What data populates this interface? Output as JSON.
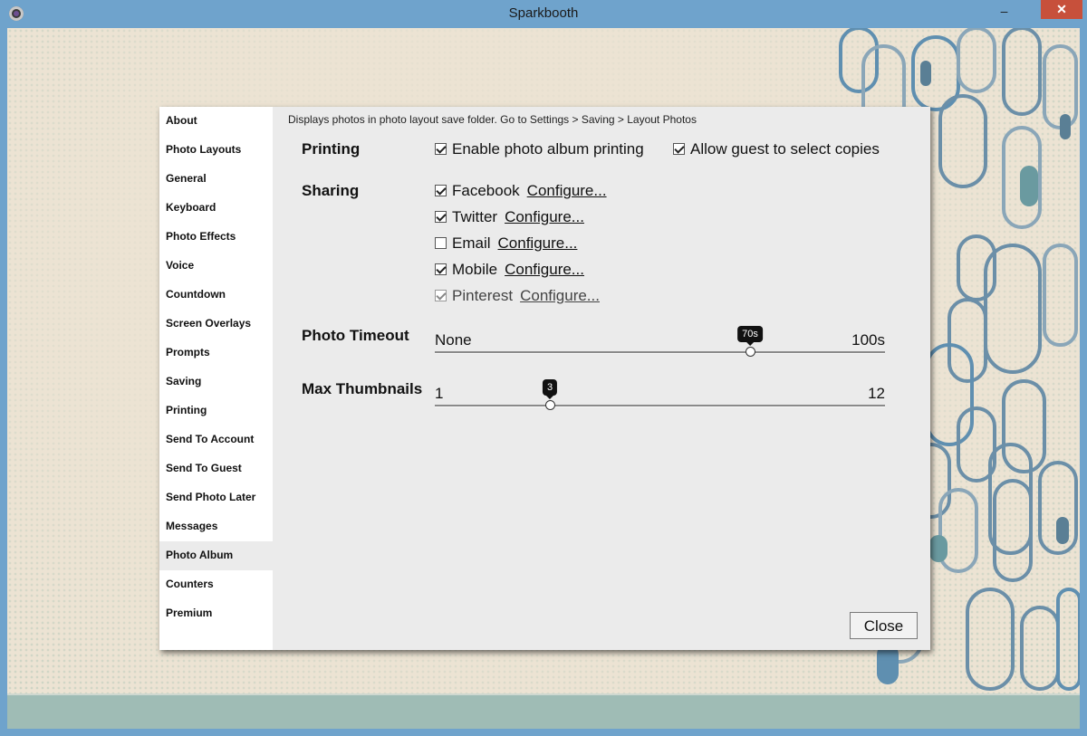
{
  "window": {
    "title": "Sparkbooth",
    "min_glyph": "–",
    "close_glyph": "✕"
  },
  "colors": {
    "titlebar": "#6fa3cc",
    "close": "#c7503b",
    "dialog": "#ebebeb",
    "sidebar": "#ffffff"
  },
  "sidebar": {
    "items": [
      {
        "label": "About"
      },
      {
        "label": "Photo Layouts"
      },
      {
        "label": "General"
      },
      {
        "label": "Keyboard"
      },
      {
        "label": "Photo Effects"
      },
      {
        "label": "Voice"
      },
      {
        "label": "Countdown"
      },
      {
        "label": "Screen Overlays"
      },
      {
        "label": "Prompts"
      },
      {
        "label": "Saving"
      },
      {
        "label": "Printing"
      },
      {
        "label": "Send To Account"
      },
      {
        "label": "Send To Guest"
      },
      {
        "label": "Send Photo Later"
      },
      {
        "label": "Messages"
      },
      {
        "label": "Photo Album"
      },
      {
        "label": "Counters"
      },
      {
        "label": "Premium"
      }
    ],
    "active": "Photo Album"
  },
  "panel": {
    "description": "Displays photos in photo layout save folder. Go to Settings > Saving > Layout Photos",
    "printing": {
      "label": "Printing",
      "enable_album_printing": {
        "label": "Enable photo album printing",
        "checked": true
      },
      "allow_guest_copies": {
        "label": "Allow guest to select copies",
        "checked": true
      }
    },
    "sharing": {
      "label": "Sharing",
      "items": [
        {
          "label": "Facebook",
          "checked": true,
          "link": "Configure..."
        },
        {
          "label": "Twitter",
          "checked": true,
          "link": "Configure..."
        },
        {
          "label": "Email",
          "checked": false,
          "link": "Configure..."
        },
        {
          "label": "Mobile",
          "checked": true,
          "link": "Configure..."
        },
        {
          "label": "Pinterest",
          "checked": true,
          "disabled": true,
          "link": "Configure..."
        }
      ]
    },
    "photo_timeout": {
      "label": "Photo Timeout",
      "min_label": "None",
      "max_label": "100s",
      "value_label": "70s",
      "fraction": 0.7
    },
    "max_thumbnails": {
      "label": "Max Thumbnails",
      "min_label": "1",
      "max_label": "12",
      "value_label": "3",
      "fraction": 0.255
    },
    "close_button": "Close"
  }
}
